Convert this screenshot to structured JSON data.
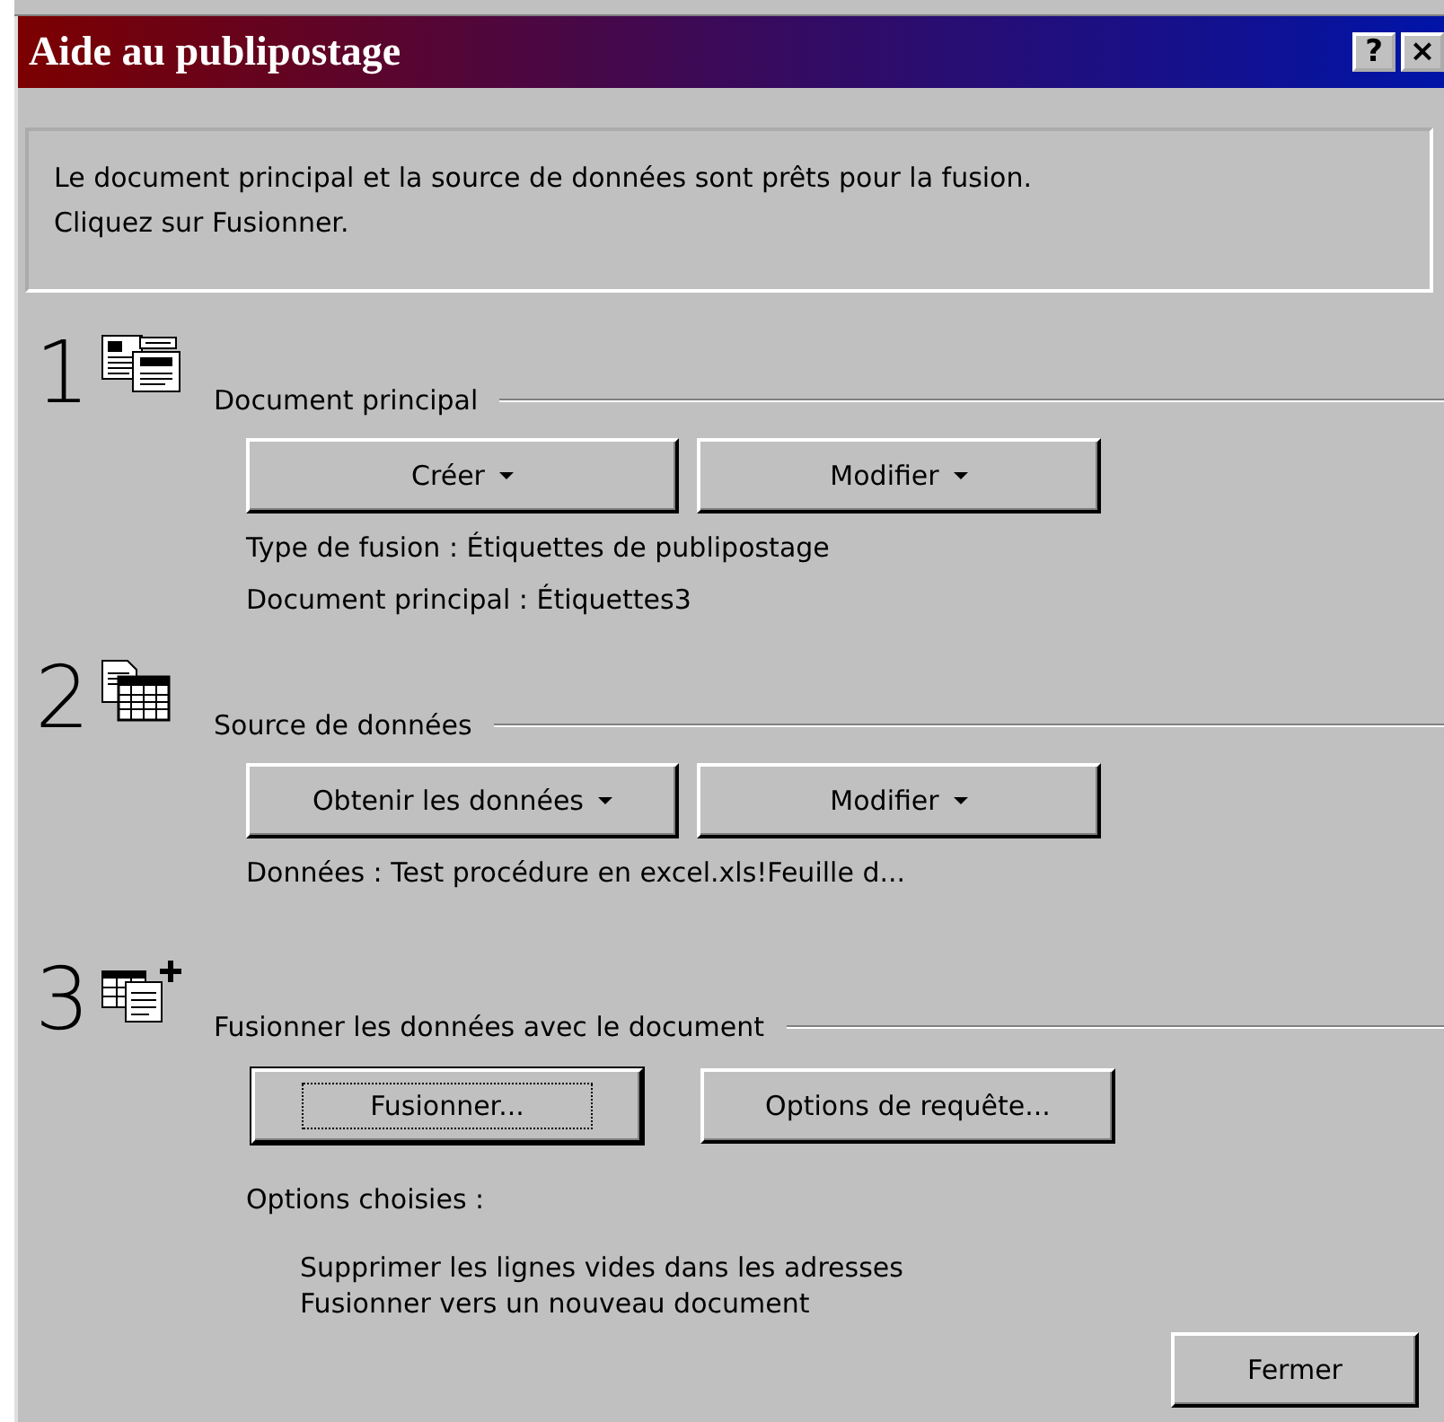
{
  "window": {
    "title": "Aide au publipostage",
    "help_button": "?",
    "close_button": "×"
  },
  "message": "Le document principal et la source de données sont prêts pour la fusion.\nCliquez sur Fusionner.",
  "sections": [
    {
      "number": "1",
      "kind": "document",
      "heading": "Document principal",
      "buttons": [
        {
          "label": "Créer",
          "dropdown": true,
          "default": false
        },
        {
          "label": "Modifier",
          "dropdown": true,
          "default": false
        }
      ],
      "info": [
        "Type de fusion : Étiquettes de publipostage",
        "Document principal : Étiquettes3"
      ]
    },
    {
      "number": "2",
      "kind": "datasource",
      "heading": "Source de données",
      "buttons": [
        {
          "label": "Obtenir les données",
          "dropdown": true,
          "default": false
        },
        {
          "label": "Modifier",
          "dropdown": true,
          "default": false
        }
      ],
      "info": [
        "Données : Test procédure en excel.xls!Feuille d..."
      ]
    },
    {
      "number": "3",
      "kind": "merge",
      "heading": "Fusionner les données avec le document",
      "buttons": [
        {
          "label": "Fusionner...",
          "dropdown": false,
          "default": true
        },
        {
          "label": "Options de requête...",
          "dropdown": false,
          "default": false
        }
      ],
      "info": [
        "Options choisies :"
      ],
      "options": [
        "Supprimer les lignes vides dans les adresses",
        "Fusionner vers un nouveau document"
      ]
    }
  ],
  "footer_button": {
    "label": "Fermer"
  }
}
